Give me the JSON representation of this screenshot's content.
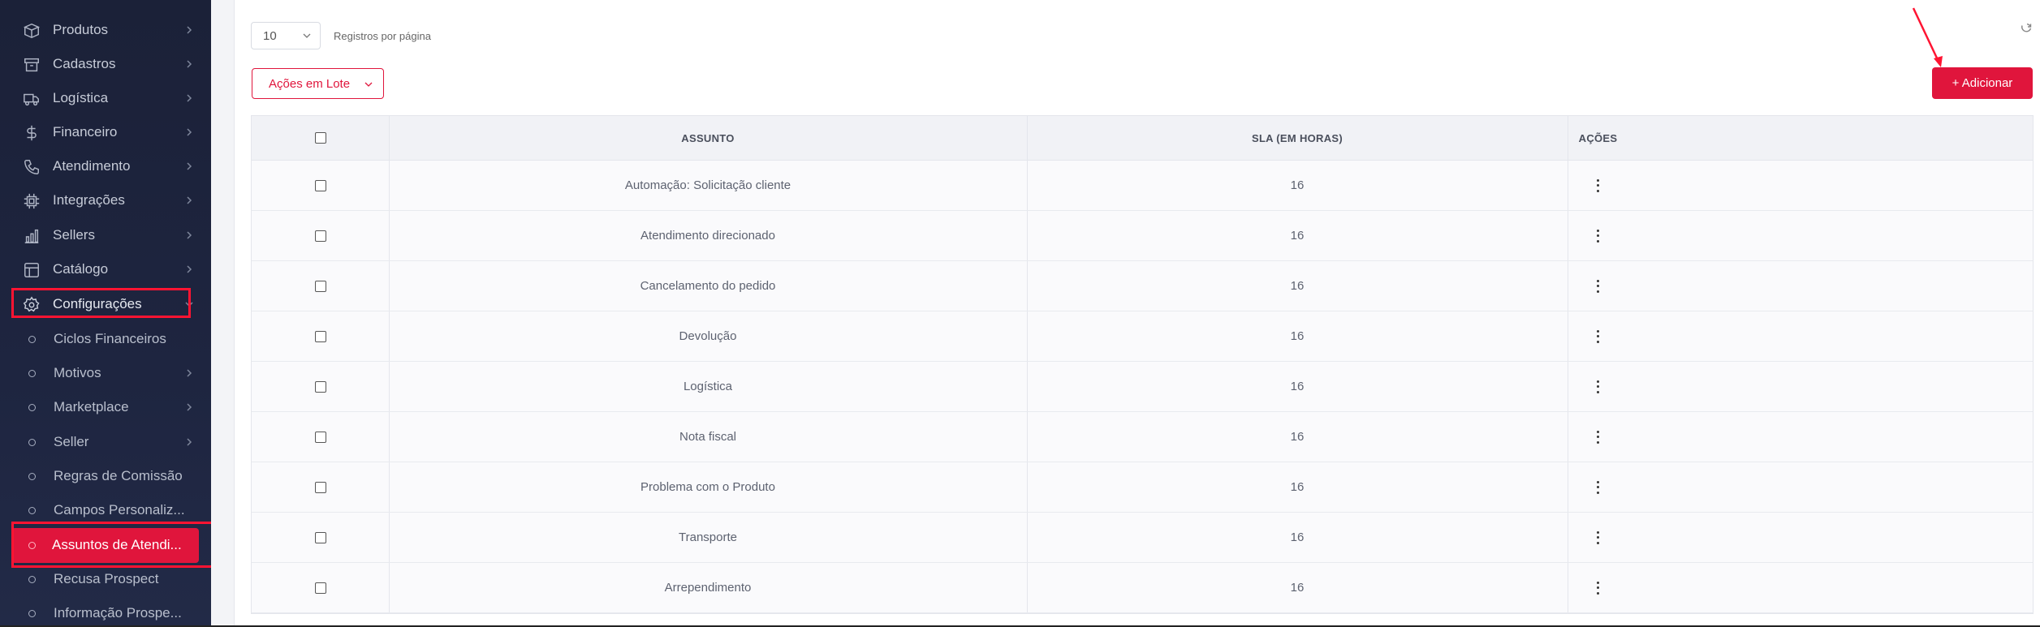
{
  "sidebar": {
    "menu": [
      {
        "label": "Produtos",
        "icon": "box-icon"
      },
      {
        "label": "Cadastros",
        "icon": "archive-icon"
      },
      {
        "label": "Logística",
        "icon": "truck-icon"
      },
      {
        "label": "Financeiro",
        "icon": "dollar-icon"
      },
      {
        "label": "Atendimento",
        "icon": "phone-icon"
      },
      {
        "label": "Integrações",
        "icon": "chip-icon"
      },
      {
        "label": "Sellers",
        "icon": "bar-chart-icon"
      },
      {
        "label": "Catálogo",
        "icon": "layout-icon"
      },
      {
        "label": "Configurações",
        "icon": "gear-icon"
      }
    ],
    "submenu": [
      {
        "label": "Ciclos Financeiros"
      },
      {
        "label": "Motivos"
      },
      {
        "label": "Marketplace"
      },
      {
        "label": "Seller"
      },
      {
        "label": "Regras de Comissão"
      },
      {
        "label": "Campos Personaliz..."
      },
      {
        "label": "Assuntos de Atendi..."
      },
      {
        "label": "Recusa Prospect"
      },
      {
        "label": "Informação Prospe..."
      }
    ]
  },
  "toolbar": {
    "per_page_value": "10",
    "per_page_label": "Registros por página",
    "bulk_actions_label": "Ações em Lote",
    "add_label": "+ Adicionar"
  },
  "table": {
    "headers": {
      "subject": "ASSUNTO",
      "sla": "SLA (EM HORAS)",
      "actions": "AÇÕES"
    },
    "rows": [
      {
        "subject": "Automação: Solicitação cliente",
        "sla": "16"
      },
      {
        "subject": "Atendimento direcionado",
        "sla": "16"
      },
      {
        "subject": "Cancelamento do pedido",
        "sla": "16"
      },
      {
        "subject": "Devolução",
        "sla": "16"
      },
      {
        "subject": "Logística",
        "sla": "16"
      },
      {
        "subject": "Nota fiscal",
        "sla": "16"
      },
      {
        "subject": "Problema com o Produto",
        "sla": "16"
      },
      {
        "subject": "Transporte",
        "sla": "16"
      },
      {
        "subject": "Arrependimento",
        "sla": "16"
      }
    ]
  },
  "colors": {
    "accent": "#e0153c",
    "sidebar_bg": "#1e2540",
    "highlight": "#ff1432"
  }
}
